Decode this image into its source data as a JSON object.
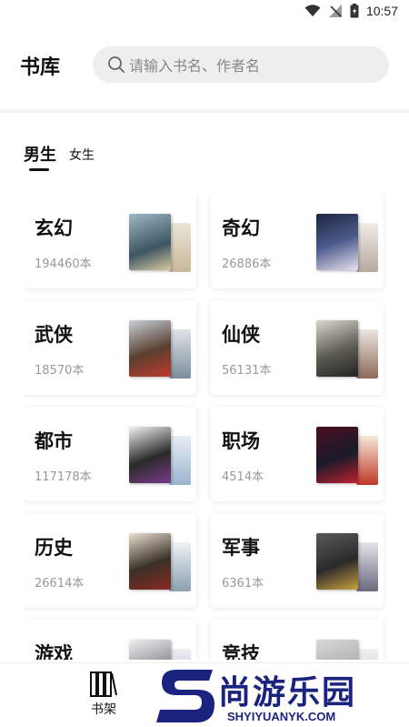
{
  "status_bar": {
    "time": "10:57"
  },
  "header": {
    "title": "书库",
    "search_placeholder": "请输入书名、作者名"
  },
  "tabs": [
    {
      "label": "男生",
      "active": true
    },
    {
      "label": "女生",
      "active": false
    }
  ],
  "categories": [
    {
      "name": "玄幻",
      "count": "194460本"
    },
    {
      "name": "奇幻",
      "count": "26886本"
    },
    {
      "name": "武侠",
      "count": "18570本"
    },
    {
      "name": "仙侠",
      "count": "56131本"
    },
    {
      "name": "都市",
      "count": "117178本"
    },
    {
      "name": "职场",
      "count": "4514本"
    },
    {
      "name": "历史",
      "count": "26614本"
    },
    {
      "name": "军事",
      "count": "6361本"
    },
    {
      "name": "游戏",
      "count": ""
    },
    {
      "name": "竞技",
      "count": ""
    }
  ],
  "bottom_nav": {
    "shelf_label": "书架"
  },
  "watermark": {
    "text": "尚游乐园",
    "url": "SHYIYUANYK.COM"
  },
  "colors": {
    "accent": "#111111",
    "watermark": "#1a237e",
    "search_bg": "#eeeeee"
  }
}
